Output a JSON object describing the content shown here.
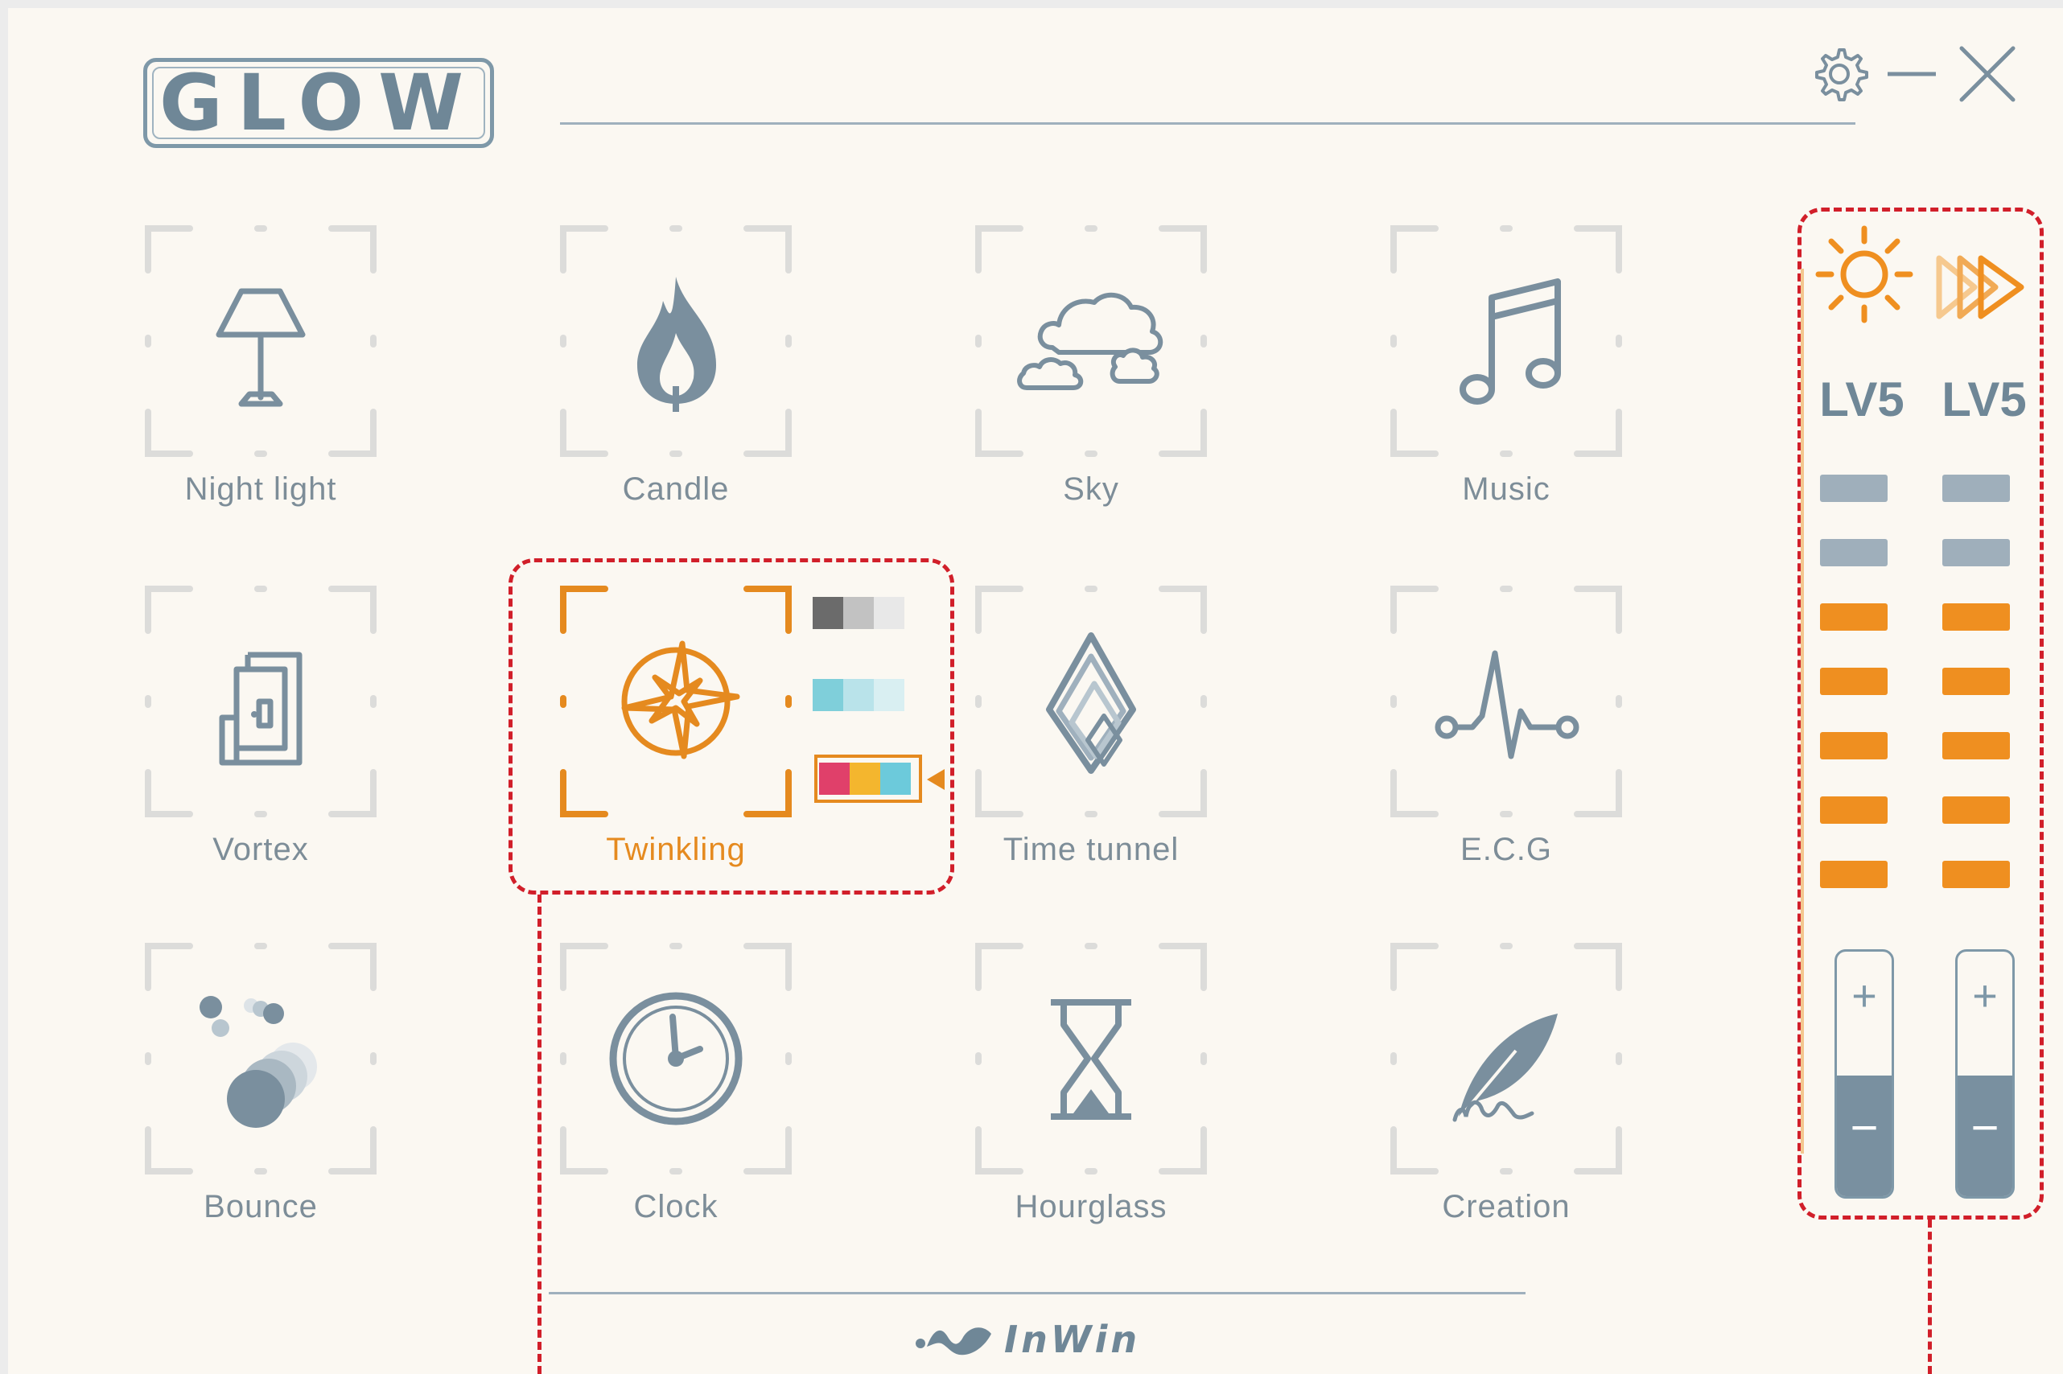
{
  "app": {
    "logo_text": "GLOW",
    "brand_text": "InWin"
  },
  "colors": {
    "accent": "#e58a1f",
    "icon": "#7a8f9e",
    "highlight": "#d11f2a",
    "background": "#fbf8f2"
  },
  "window_controls": [
    {
      "name": "settings",
      "icon": "gear-icon"
    },
    {
      "name": "minimize",
      "icon": "minus-icon"
    },
    {
      "name": "close",
      "icon": "close-icon"
    }
  ],
  "modes": [
    {
      "label": "Night light",
      "icon": "lamp-icon",
      "active": false
    },
    {
      "label": "Candle",
      "icon": "flame-icon",
      "active": false
    },
    {
      "label": "Sky",
      "icon": "cloud-icon",
      "active": false
    },
    {
      "label": "Music",
      "icon": "music-note-icon",
      "active": false
    },
    {
      "label": "Vortex",
      "icon": "vortex-icon",
      "active": false
    },
    {
      "label": "Twinkling",
      "icon": "twinkling-star-icon",
      "active": true
    },
    {
      "label": "Time tunnel",
      "icon": "time-tunnel-icon",
      "active": false
    },
    {
      "label": "E.C.G",
      "icon": "ecg-pulse-icon",
      "active": false
    },
    {
      "label": "Bounce",
      "icon": "bouncing-balls-icon",
      "active": false
    },
    {
      "label": "Clock",
      "icon": "clock-icon",
      "active": false
    },
    {
      "label": "Hourglass",
      "icon": "hourglass-icon",
      "active": false
    },
    {
      "label": "Creation",
      "icon": "quill-icon",
      "active": false
    }
  ],
  "color_options": [
    {
      "colors": [
        "#6b6b6b",
        "#c2c2c2",
        "#e8e8e8"
      ],
      "selected": false
    },
    {
      "colors": [
        "#7fcfda",
        "#b9e3ea",
        "#d9eff2"
      ],
      "selected": false
    },
    {
      "colors": [
        "#e0406a",
        "#f4b62e",
        "#6ccadb"
      ],
      "selected": true
    }
  ],
  "levels": {
    "brightness": {
      "icon": "sun-icon",
      "label": "LV5",
      "value": 5,
      "max": 7
    },
    "speed": {
      "icon": "fast-forward-icon",
      "label": "LV5",
      "value": 5,
      "max": 7
    },
    "plus_label": "+",
    "minus_label": "−"
  }
}
